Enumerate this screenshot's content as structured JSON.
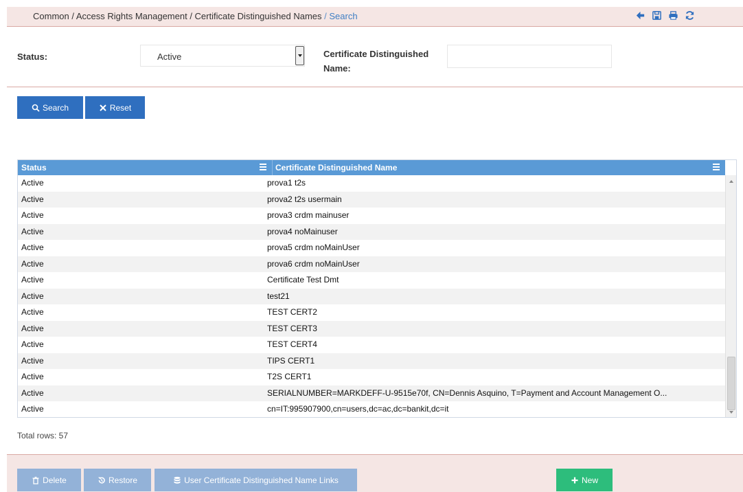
{
  "breadcrumb": {
    "path": "Common / Access Rights Management / Certificate Distinguished Names",
    "separator": "/",
    "current": "Search"
  },
  "toolbar": {
    "icons": [
      "back-icon",
      "save-icon",
      "print-icon",
      "refresh-icon"
    ]
  },
  "filters": {
    "status_label": "Status:",
    "status_value": "Active",
    "cdn_label_line1": "Certificate Distinguished",
    "cdn_label_line2": "Name:",
    "cdn_value": ""
  },
  "actions": {
    "search_label": "Search",
    "reset_label": "Reset"
  },
  "grid": {
    "columns": [
      "Status",
      "Certificate Distinguished Name"
    ],
    "rows": [
      {
        "status": "Active",
        "name": "prova1 t2s"
      },
      {
        "status": "Active",
        "name": "prova2 t2s usermain"
      },
      {
        "status": "Active",
        "name": "prova3 crdm mainuser"
      },
      {
        "status": "Active",
        "name": "prova4 noMainuser"
      },
      {
        "status": "Active",
        "name": "prova5 crdm noMainUser"
      },
      {
        "status": "Active",
        "name": "prova6 crdm noMainUser"
      },
      {
        "status": "Active",
        "name": "Certificate Test Dmt"
      },
      {
        "status": "Active",
        "name": "test21"
      },
      {
        "status": "Active",
        "name": "TEST CERT2"
      },
      {
        "status": "Active",
        "name": "TEST CERT3"
      },
      {
        "status": "Active",
        "name": "TEST CERT4"
      },
      {
        "status": "Active",
        "name": "TIPS CERT1"
      },
      {
        "status": "Active",
        "name": "T2S CERT1"
      },
      {
        "status": "Active",
        "name": "SERIALNUMBER=MARKDEFF-U-9515e70f, CN=Dennis Asquino, T=Payment and Account Management O..."
      },
      {
        "status": "Active",
        "name": "cn=IT:995907900,cn=users,dc=ac,dc=bankit,dc=it"
      }
    ],
    "total_rows_text": "Total rows: 57"
  },
  "footer": {
    "delete_label": "Delete",
    "restore_label": "Restore",
    "links_label": "User Certificate Distinguished Name Links",
    "new_label": "New"
  },
  "colors": {
    "primary": "#2f6fbf",
    "disabled": "#93b2d8",
    "success": "#2dbd7c",
    "header": "#5a9ad6",
    "band": "#f5e6e4"
  }
}
